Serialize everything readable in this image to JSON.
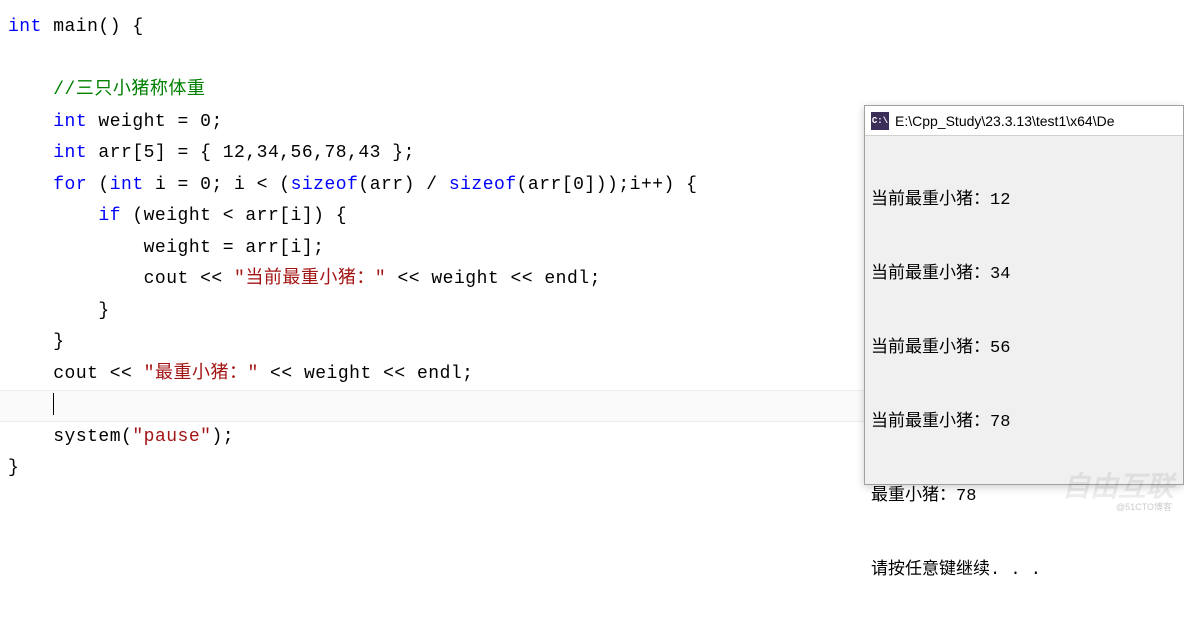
{
  "code": {
    "line1_int": "int",
    "line1_main": " main() {",
    "comment": "//三只小猪称体重",
    "line3_int": "int",
    "line3_rest": " weight = 0;",
    "line4_int": "int",
    "line4_rest": " arr[5] = { 12,34,56,78,43 };",
    "line5_for": "for",
    "line5_a": " (",
    "line5_int": "int",
    "line5_b": " i = 0; i < (",
    "line5_sizeof1": "sizeof",
    "line5_c": "(arr) / ",
    "line5_sizeof2": "sizeof",
    "line5_d": "(arr[0]));i++) {",
    "line6_if": "if",
    "line6_rest": " (weight < arr[i]) {",
    "line7": "weight = arr[i];",
    "line8_a": "cout << ",
    "line8_str": "\"当前最重小猪：\"",
    "line8_b": " << weight << endl;",
    "line9": "}",
    "line10": "}",
    "line11_a": "cout << ",
    "line11_str": "\"最重小猪：\"",
    "line11_b": " << weight << endl;",
    "line13": "system(",
    "line13_str": "\"pause\"",
    "line13_b": ");",
    "line14": "}"
  },
  "console": {
    "title": "E:\\Cpp_Study\\23.3.13\\test1\\x64\\De",
    "icon_text": "C:\\",
    "lines": [
      "当前最重小猪：12",
      "当前最重小猪：34",
      "当前最重小猪：56",
      "当前最重小猪：78",
      "最重小猪：78",
      "请按任意键继续. . ."
    ]
  },
  "watermark": {
    "text": "自由互联",
    "credit": "@51CTO博客"
  }
}
